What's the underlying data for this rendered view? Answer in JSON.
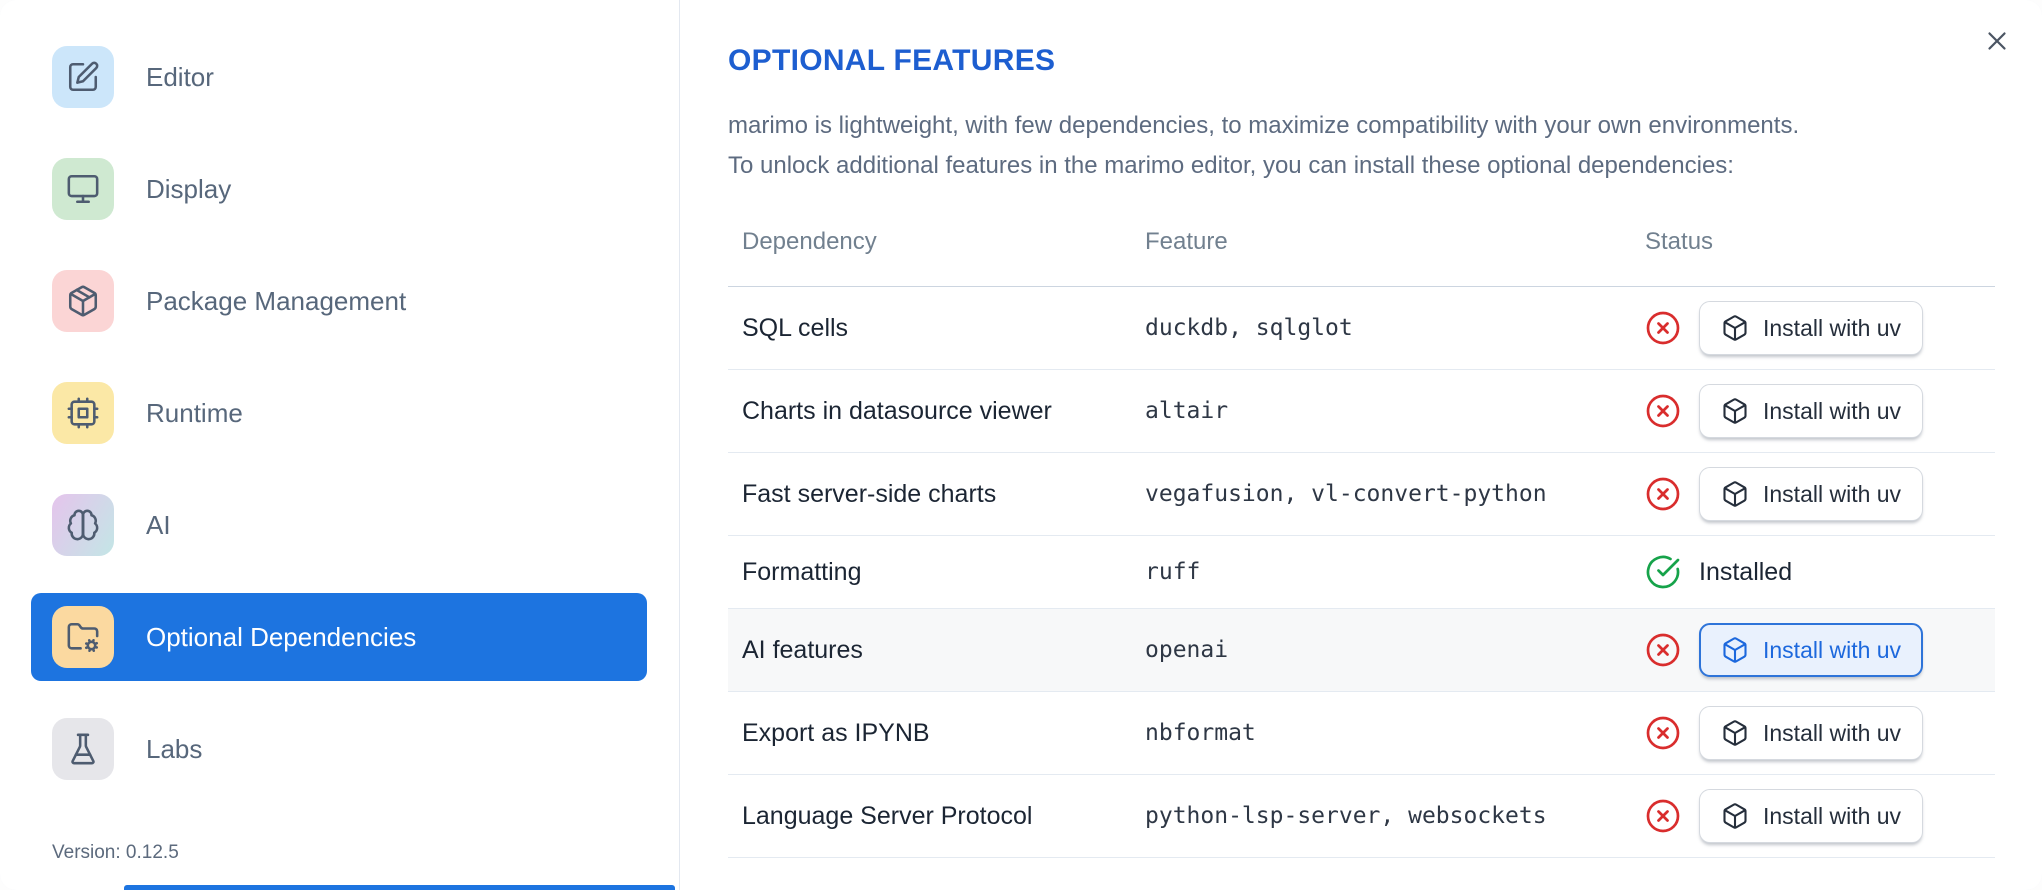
{
  "dialog": {
    "close_icon": "x-icon"
  },
  "sidebar": {
    "items": [
      {
        "label": "Editor",
        "icon": "edit-icon",
        "icon_bg": "#cce6fa",
        "selected": false
      },
      {
        "label": "Display",
        "icon": "monitor-icon",
        "icon_bg": "#cfe9d1",
        "selected": false
      },
      {
        "label": "Package Management",
        "icon": "package-icon",
        "icon_bg": "#fbd5d5",
        "selected": false
      },
      {
        "label": "Runtime",
        "icon": "cpu-icon",
        "icon_bg": "#fbe8a6",
        "selected": false
      },
      {
        "label": "AI",
        "icon": "brain-icon",
        "icon_bg": "#e5c4ec",
        "icon_bg2": "#c3e6e6",
        "selected": false
      },
      {
        "label": "Optional Dependencies",
        "icon": "folder-cog-icon",
        "icon_bg": "#fbd9a0",
        "selected": true
      },
      {
        "label": "Labs",
        "icon": "flask-icon",
        "icon_bg": "#e6e6ea",
        "selected": false
      }
    ],
    "version_label": "Version: 0.12.5"
  },
  "main": {
    "title": "OPTIONAL FEATURES",
    "description_line1": "marimo is lightweight, with few dependencies, to maximize compatibility with your own environments.",
    "description_line2": "To unlock additional features in the marimo editor, you can install these optional dependencies:",
    "table": {
      "columns": [
        "Dependency",
        "Feature",
        "Status"
      ],
      "rows": [
        {
          "dependency": "SQL cells",
          "feature": "duckdb, sqlglot",
          "status": "missing",
          "status_icon": "circle-x-icon",
          "action": "Install with uv",
          "action_icon": "box-icon",
          "focused": false
        },
        {
          "dependency": "Charts in datasource viewer",
          "feature": "altair",
          "status": "missing",
          "status_icon": "circle-x-icon",
          "action": "Install with uv",
          "action_icon": "box-icon",
          "focused": false
        },
        {
          "dependency": "Fast server-side charts",
          "feature": "vegafusion, vl-convert-python",
          "status": "missing",
          "status_icon": "circle-x-icon",
          "action": "Install with uv",
          "action_icon": "box-icon",
          "focused": false
        },
        {
          "dependency": "Formatting",
          "feature": "ruff",
          "status": "installed",
          "status_icon": "circle-check-icon",
          "status_label": "Installed",
          "focused": false
        },
        {
          "dependency": "AI features",
          "feature": "openai",
          "status": "missing",
          "status_icon": "circle-x-icon",
          "action": "Install with uv",
          "action_icon": "box-icon",
          "focused": true
        },
        {
          "dependency": "Export as IPYNB",
          "feature": "nbformat",
          "status": "missing",
          "status_icon": "circle-x-icon",
          "action": "Install with uv",
          "action_icon": "box-icon",
          "focused": false
        },
        {
          "dependency": "Language Server Protocol",
          "feature": "python-lsp-server, websockets",
          "status": "missing",
          "status_icon": "circle-x-icon",
          "action": "Install with uv",
          "action_icon": "box-icon",
          "focused": false
        }
      ]
    }
  },
  "colors": {
    "accent_blue": "#1d74e0",
    "title_blue": "#1d5ed0",
    "status_error_red": "#d92d2d",
    "status_success_green": "#16a34a",
    "focused_button_blue": "#1c68dd",
    "sidebar_text": "#57677b",
    "body_text": "#5d6b80"
  }
}
